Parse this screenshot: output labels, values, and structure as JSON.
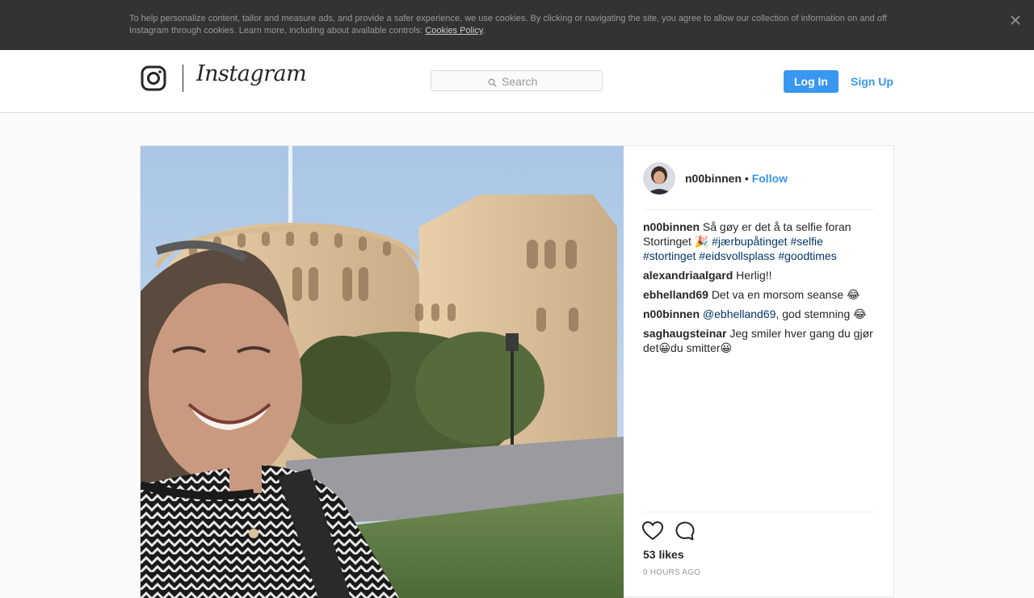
{
  "cookie_banner": {
    "text": "To help personalize content, tailor and measure ads, and provide a safer experience, we use cookies. By clicking or navigating the site, you agree to allow our collection of information on and off Instagram through cookies. Learn more, including about available controls: ",
    "link": "Cookies Policy",
    "end": ".",
    "close_icon": "close-icon"
  },
  "header": {
    "logo_icon": "instagram-glyph-icon",
    "wordmark": "Instagram",
    "search_placeholder": "Search",
    "search_icon": "search-icon",
    "login_label": "Log In",
    "signup_label": "Sign Up"
  },
  "post": {
    "image_description": "Selfie of smiling woman in front of the Storting building",
    "author": "n00binnen",
    "separator": " • ",
    "follow_label": "Follow",
    "caption": {
      "user": "n00binnen",
      "text": "Så gøy er det å ta selfie foran Stortinget 🎉",
      "hashtags": [
        "#jærbupåtinget",
        "#selfie",
        "#stortinget",
        "#eidsvollsplass",
        "#goodtimes"
      ]
    },
    "comments": [
      {
        "user": "alexandriaalgard",
        "text": "Herlig!!"
      },
      {
        "user": "ebhelland69",
        "text": "Det va en morsom seanse 😂"
      },
      {
        "user": "n00binnen",
        "mention": "@ebhelland69",
        "text": ", god stemning 😂"
      },
      {
        "user": "saghaugsteinar",
        "text": "Jeg smiler hver gang du gjør det😀du smitter😀"
      }
    ],
    "likes": "53 likes",
    "time": "9 HOURS AGO",
    "icons": {
      "like": "heart-icon",
      "comment": "comment-icon"
    },
    "colors": {
      "accent": "#3897f0",
      "hashtag": "#003569"
    }
  }
}
